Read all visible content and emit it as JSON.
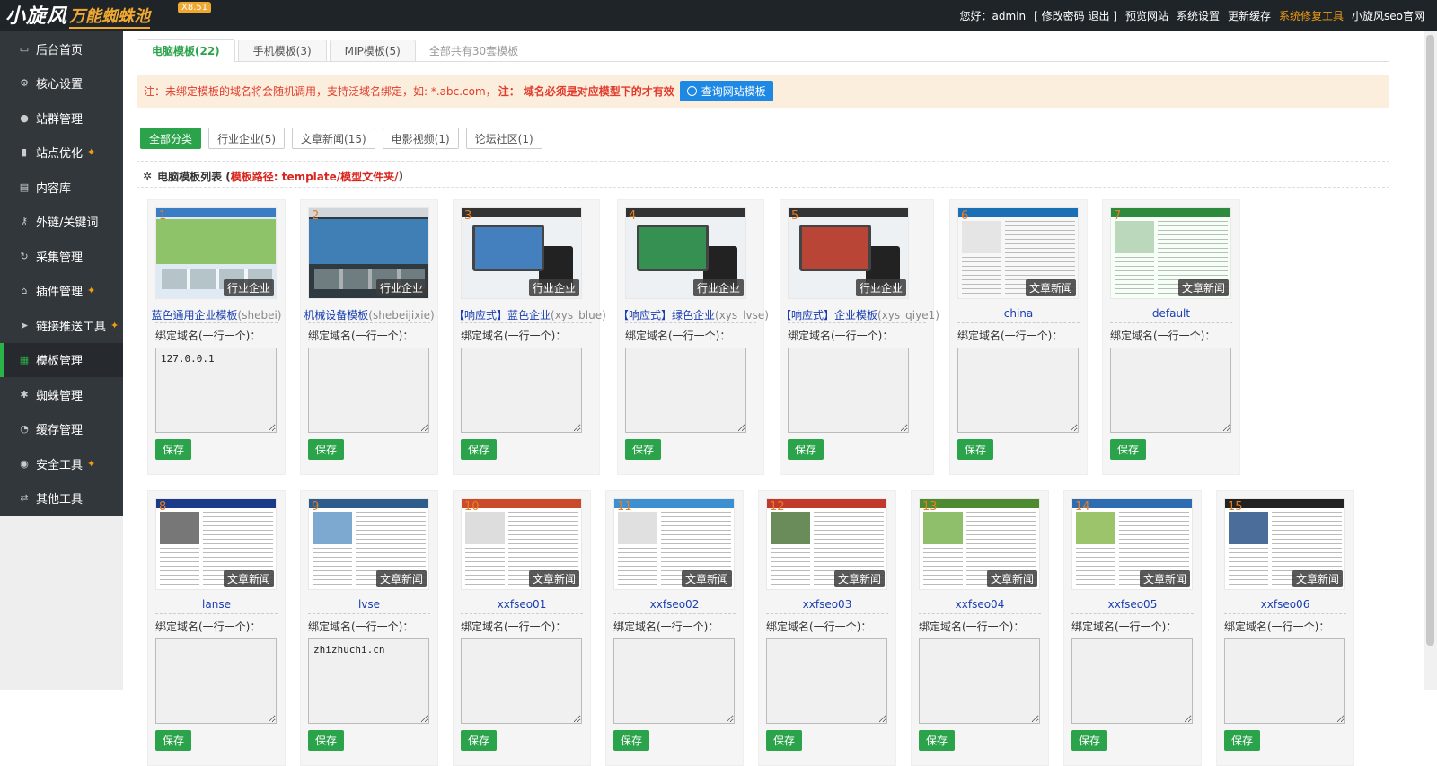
{
  "header": {
    "logo_main": "小旋风",
    "logo_sub": "万能蜘蛛池",
    "version": "X8.51",
    "greeting": "您好：admin",
    "links": [
      "[ 修改密码 退出 ]",
      "预览网站",
      "系统设置",
      "更新缓存",
      "系统修复工具",
      "小旋风seo官网"
    ],
    "highlight_color": "#f39c12"
  },
  "sidebar": {
    "items": [
      {
        "label": "后台首页",
        "icon": "monitor-icon",
        "pin": false,
        "active": false
      },
      {
        "label": "核心设置",
        "icon": "gear-icon",
        "pin": false,
        "active": false
      },
      {
        "label": "站群管理",
        "icon": "user-icon",
        "pin": false,
        "active": false
      },
      {
        "label": "站点优化",
        "icon": "bar-chart-icon",
        "pin": true,
        "active": false
      },
      {
        "label": "内容库",
        "icon": "document-icon",
        "pin": false,
        "active": false
      },
      {
        "label": "外链/关键词",
        "icon": "key-icon",
        "pin": false,
        "active": false
      },
      {
        "label": "采集管理",
        "icon": "refresh-icon",
        "pin": false,
        "active": false
      },
      {
        "label": "插件管理",
        "icon": "plug-icon",
        "pin": true,
        "active": false
      },
      {
        "label": "链接推送工具",
        "icon": "send-icon",
        "pin": true,
        "active": false
      },
      {
        "label": "模板管理",
        "icon": "windows-icon",
        "pin": false,
        "active": true
      },
      {
        "label": "蜘蛛管理",
        "icon": "spider-icon",
        "pin": false,
        "active": false
      },
      {
        "label": "缓存管理",
        "icon": "dashboard-icon",
        "pin": false,
        "active": false
      },
      {
        "label": "安全工具",
        "icon": "bulb-icon",
        "pin": true,
        "active": false
      },
      {
        "label": "其他工具",
        "icon": "shuffle-icon",
        "pin": false,
        "active": false
      }
    ],
    "active_color": "#2bb34a"
  },
  "tabs": {
    "items": [
      "电脑模板(22)",
      "手机模板(3)",
      "MIP模板(5)"
    ],
    "info": "全部共有30套模板"
  },
  "notice": {
    "text1": "注：未绑定模板的域名将会随机调用，支持泛域名绑定，如: *.abc.com，",
    "bold1": "注：",
    "text2": "域名必须是对应模型下的才有效",
    "button": "查询网站模板"
  },
  "filters": [
    "全部分类",
    "行业企业(5)",
    "文章新闻(15)",
    "电影视频(1)",
    "论坛社区(1)"
  ],
  "section": {
    "title": "电脑模板列表 (",
    "path": " 模板路径: template/模型文件夹/ ",
    "close": ")"
  },
  "bind_label": "绑定域名(一行一个)：",
  "save_label": "保存",
  "templates": [
    {
      "num": "1",
      "name": "蓝色通用企业模板",
      "dir": "(shebei)",
      "category": "行业企业",
      "domains": "127.0.0.1"
    },
    {
      "num": "2",
      "name": "机械设备模板",
      "dir": "(shebeijixie)",
      "category": "行业企业",
      "domains": ""
    },
    {
      "num": "3",
      "name": "【响应式】蓝色企业",
      "dir": "(xys_blue)",
      "category": "行业企业",
      "domains": ""
    },
    {
      "num": "4",
      "name": "【响应式】绿色企业",
      "dir": "(xys_lvse)",
      "category": "行业企业",
      "domains": ""
    },
    {
      "num": "5",
      "name": "【响应式】企业模板",
      "dir": "(xys_qiye1)",
      "category": "行业企业",
      "domains": ""
    },
    {
      "num": "6",
      "name": "china",
      "dir": "",
      "category": "文章新闻",
      "domains": ""
    },
    {
      "num": "7",
      "name": "default",
      "dir": "",
      "category": "文章新闻",
      "domains": ""
    },
    {
      "num": "8",
      "name": "lanse",
      "dir": "",
      "category": "文章新闻",
      "domains": ""
    },
    {
      "num": "9",
      "name": "lvse",
      "dir": "",
      "category": "文章新闻",
      "domains": "zhizhuchi.cn"
    },
    {
      "num": "10",
      "name": "xxfseo01",
      "dir": "",
      "category": "文章新闻",
      "domains": ""
    },
    {
      "num": "11",
      "name": "xxfseo02",
      "dir": "",
      "category": "文章新闻",
      "domains": ""
    },
    {
      "num": "12",
      "name": "xxfseo03",
      "dir": "",
      "category": "文章新闻",
      "domains": ""
    },
    {
      "num": "13",
      "name": "xxfseo04",
      "dir": "",
      "category": "文章新闻",
      "domains": ""
    },
    {
      "num": "14",
      "name": "xxfseo05",
      "dir": "",
      "category": "文章新闻",
      "domains": ""
    },
    {
      "num": "15",
      "name": "xxfseo06",
      "dir": "",
      "category": "文章新闻",
      "domains": ""
    }
  ]
}
